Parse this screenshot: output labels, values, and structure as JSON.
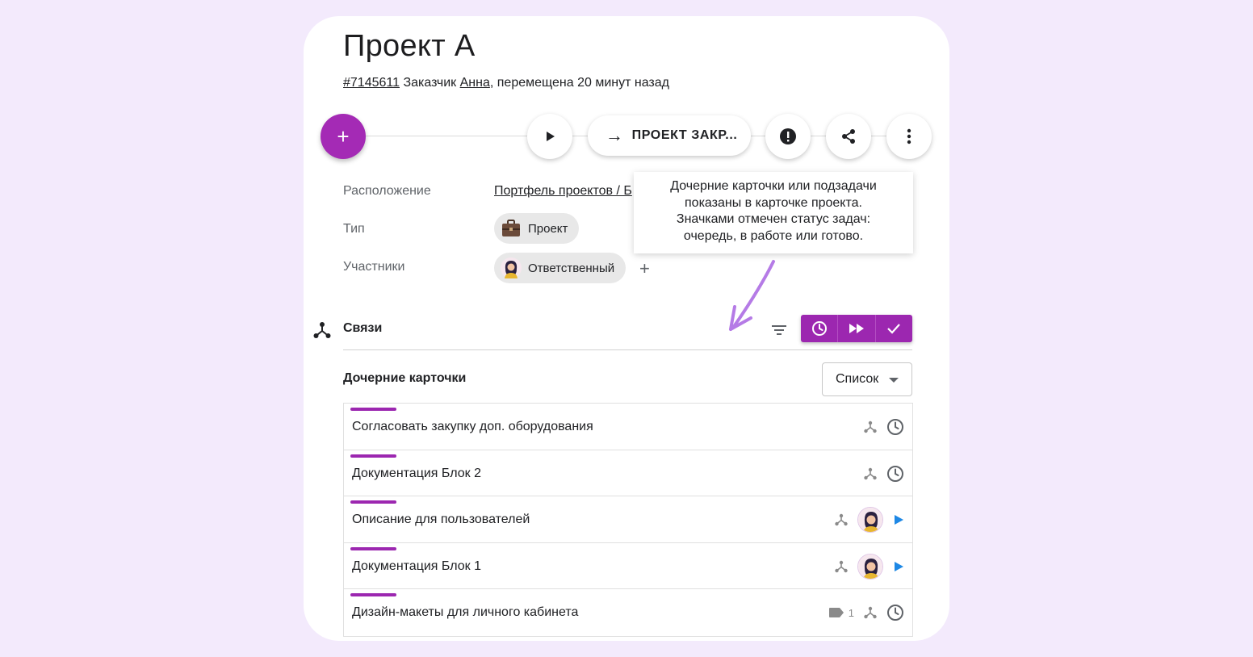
{
  "project": {
    "title": "Проект А",
    "id_link": "#7145611",
    "customer_label": "Заказчик",
    "customer_name": "Анна",
    "moved_text": ", перемещена 20 минут назад"
  },
  "toolbar": {
    "add_label": "+",
    "status_button_label": "ПРОЕКТ ЗАКР...",
    "status_arrow": "→"
  },
  "properties": {
    "location_label": "Расположение",
    "location_value": "Портфель проектов / Б",
    "type_label": "Тип",
    "type_value": "Проект",
    "members_label": "Участники",
    "members_value": "Ответственный",
    "add_member_label": "+"
  },
  "tooltip": {
    "lines": [
      "Дочерние карточки или подзадачи",
      "показаны в карточке проекта.",
      "Значками отмечен статус задач:",
      "очередь, в работе или готово."
    ]
  },
  "links": {
    "title": "Связи",
    "children_title": "Дочерние карточки",
    "view_select": "Список"
  },
  "children": [
    {
      "name": "Согласовать закупку доп. оборудования",
      "status": "queue"
    },
    {
      "name": "Документация Блок 2",
      "status": "queue"
    },
    {
      "name": "Описание для пользователей",
      "status": "in-progress"
    },
    {
      "name": "Документация Блок 1",
      "status": "in-progress"
    },
    {
      "name": "Дизайн-макеты для личного кабинета",
      "status": "queue",
      "tag_count": "1"
    }
  ],
  "colors": {
    "accent": "#9c27b0",
    "fab": "#a42ab5",
    "in_progress": "#1e88e5",
    "background": "#f3eafc"
  }
}
